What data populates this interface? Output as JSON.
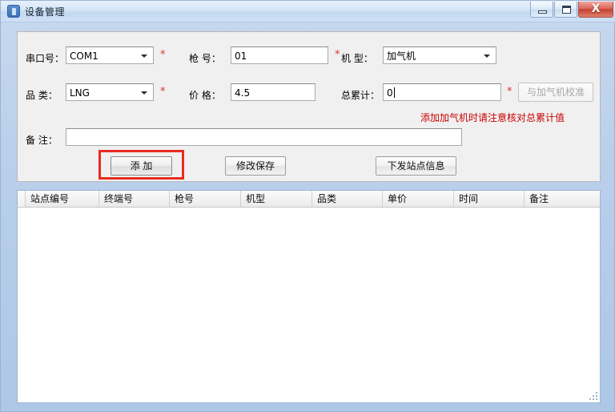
{
  "window": {
    "title": "设备管理",
    "icon": "device-icon",
    "controls": {
      "minimize": "–",
      "maximize": "□",
      "close": "X"
    }
  },
  "form": {
    "fields": {
      "port_label": "串口号：",
      "port_value": "COM1",
      "gun_label": "枪  号：",
      "gun_value": "01",
      "model_label": "机  型：",
      "model_value": "加气机",
      "category_label": "品  类：",
      "category_value": "LNG",
      "price_label": "价  格：",
      "price_value": "4.5",
      "total_label": "总累计：",
      "total_value": "0",
      "remark_label": "备  注：",
      "remark_value": ""
    },
    "required_marks": {
      "port": "*",
      "gun": "*",
      "category": "*",
      "total": "*"
    },
    "calibrate_button": "与加气机校准",
    "warning_text": "添加加气机时请注意核对总累计值"
  },
  "actions": {
    "add": "添  加",
    "save": "修改保存",
    "dispatch": "下发站点信息"
  },
  "table": {
    "columns": [
      "站点编号",
      "终端号",
      "枪号",
      "机型",
      "品类",
      "单价",
      "时间",
      "备注"
    ],
    "rows": []
  },
  "colors": {
    "accent_red": "#cc0000",
    "highlight": "#e82c21",
    "window_frame": "#aec7e6"
  }
}
